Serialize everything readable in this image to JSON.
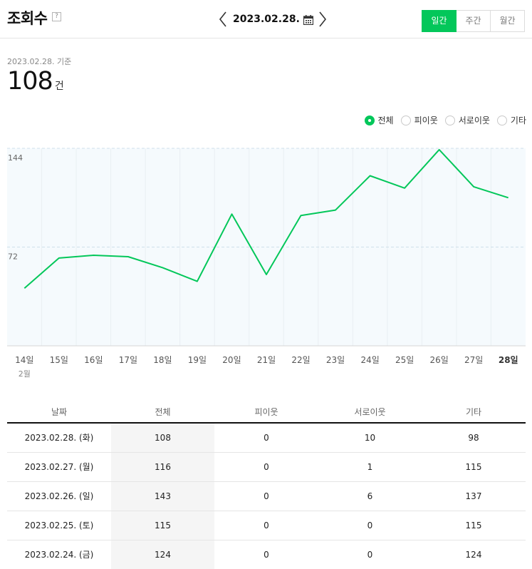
{
  "header": {
    "title": "조회수",
    "help": "?",
    "date": "2023.02.28.",
    "periods": [
      {
        "label": "일간",
        "active": true
      },
      {
        "label": "주간",
        "active": false
      },
      {
        "label": "월간",
        "active": false
      }
    ]
  },
  "summary": {
    "basis": "2023.02.28. 기준",
    "count": "108",
    "unit": "건"
  },
  "legend": [
    {
      "label": "전체",
      "selected": true
    },
    {
      "label": "피이웃",
      "selected": false
    },
    {
      "label": "서로이웃",
      "selected": false
    },
    {
      "label": "기타",
      "selected": false
    }
  ],
  "colors": {
    "accent": "#03c75a",
    "plot_bg": "#f5fafd"
  },
  "chart_data": {
    "type": "line",
    "categories": [
      "14일",
      "15일",
      "16일",
      "17일",
      "18일",
      "19일",
      "20일",
      "21일",
      "22일",
      "23일",
      "24일",
      "25일",
      "26일",
      "27일",
      "28일"
    ],
    "values": [
      42,
      64,
      66,
      65,
      57,
      47,
      96,
      52,
      95,
      99,
      124,
      115,
      143,
      116,
      108
    ],
    "yticks": [
      "144",
      "72"
    ],
    "ylim": [
      0,
      144
    ],
    "month_label": "2월",
    "highlight_category": "28일"
  },
  "table": {
    "headers": [
      "날짜",
      "전체",
      "피이웃",
      "서로이웃",
      "기타"
    ],
    "rows": [
      [
        "2023.02.28. (화)",
        "108",
        "0",
        "10",
        "98"
      ],
      [
        "2023.02.27. (월)",
        "116",
        "0",
        "1",
        "115"
      ],
      [
        "2023.02.26. (일)",
        "143",
        "0",
        "6",
        "137"
      ],
      [
        "2023.02.25. (토)",
        "115",
        "0",
        "0",
        "115"
      ],
      [
        "2023.02.24. (금)",
        "124",
        "0",
        "0",
        "124"
      ]
    ]
  }
}
